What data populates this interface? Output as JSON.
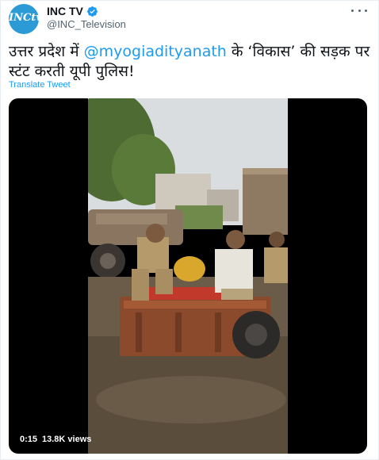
{
  "author": {
    "display_name": "INC TV",
    "handle": "@INC_Television",
    "avatar_text": "INCtv",
    "verified_icon": "verified-badge-icon"
  },
  "tweet": {
    "text_before": "उत्तर प्रदेश में ",
    "mention": "@myogiadityanath",
    "text_after": " के ‘विकास’ की सड़क पर स्टंट करती यूपी पुलिस!",
    "translate_label": "Translate Tweet"
  },
  "video": {
    "duration": "0:15",
    "views": "13.8K views"
  },
  "colors": {
    "accent": "#1d9bf0",
    "avatar_bg": "#2c9bd5",
    "text": "#0f1419",
    "secondary": "#536471"
  }
}
